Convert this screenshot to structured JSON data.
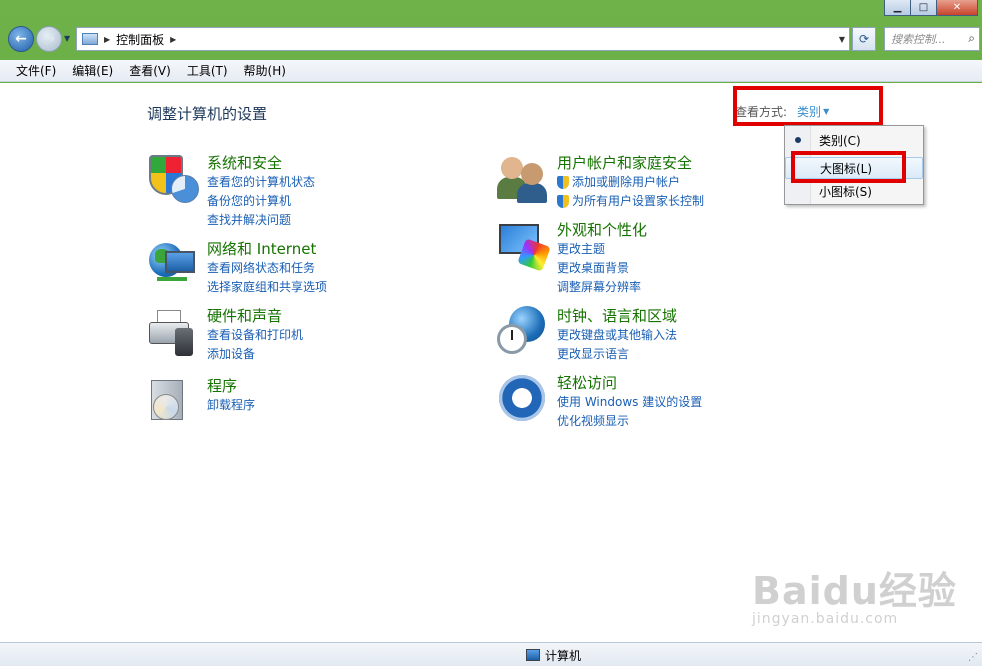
{
  "window": {
    "min_glyph": "▁",
    "max_glyph": "□",
    "close_glyph": "✕"
  },
  "address": {
    "path": "控制面板",
    "search_placeholder": "搜索控制..."
  },
  "menu": [
    "文件(F)",
    "编辑(E)",
    "查看(V)",
    "工具(T)",
    "帮助(H)"
  ],
  "main": {
    "title": "调整计算机的设置",
    "view_by_label": "查看方式:",
    "view_by_value": "类别"
  },
  "categories": [
    {
      "title": "系统和安全",
      "links": [
        "查看您的计算机状态",
        "备份您的计算机",
        "查找并解决问题"
      ],
      "icon": "security-shield-icon"
    },
    {
      "title": "网络和 Internet",
      "links": [
        "查看网络状态和任务",
        "选择家庭组和共享选项"
      ],
      "icon": "network-globe-icon"
    },
    {
      "title": "硬件和声音",
      "links": [
        "查看设备和打印机",
        "添加设备"
      ],
      "icon": "printer-icon"
    },
    {
      "title": "程序",
      "links": [
        "卸载程序"
      ],
      "icon": "programs-box-icon"
    },
    {
      "title": "用户帐户和家庭安全",
      "links": [
        "添加或删除用户帐户",
        "为所有用户设置家长控制"
      ],
      "icon": "users-icon"
    },
    {
      "title": "外观和个性化",
      "links": [
        "更改主题",
        "更改桌面背景",
        "调整屏幕分辨率"
      ],
      "icon": "display-palette-icon"
    },
    {
      "title": "时钟、语言和区域",
      "links": [
        "更改键盘或其他输入法",
        "更改显示语言"
      ],
      "icon": "clock-globe-icon"
    },
    {
      "title": "轻松访问",
      "links": [
        "使用 Windows 建议的设置",
        "优化视频显示"
      ],
      "icon": "ease-of-access-icon"
    }
  ],
  "dropdown": {
    "items": [
      "类别(C)",
      "大图标(L)",
      "小图标(S)"
    ],
    "selected": "类别(C)",
    "hovered": "大图标(L)"
  },
  "status": {
    "text": "计算机"
  },
  "watermark": {
    "brand": "Baidu经验",
    "url": "jingyan.baidu.com"
  },
  "colors": {
    "link": "#1a5fb4",
    "category_title": "#157300",
    "highlight_box": "#e00000"
  }
}
